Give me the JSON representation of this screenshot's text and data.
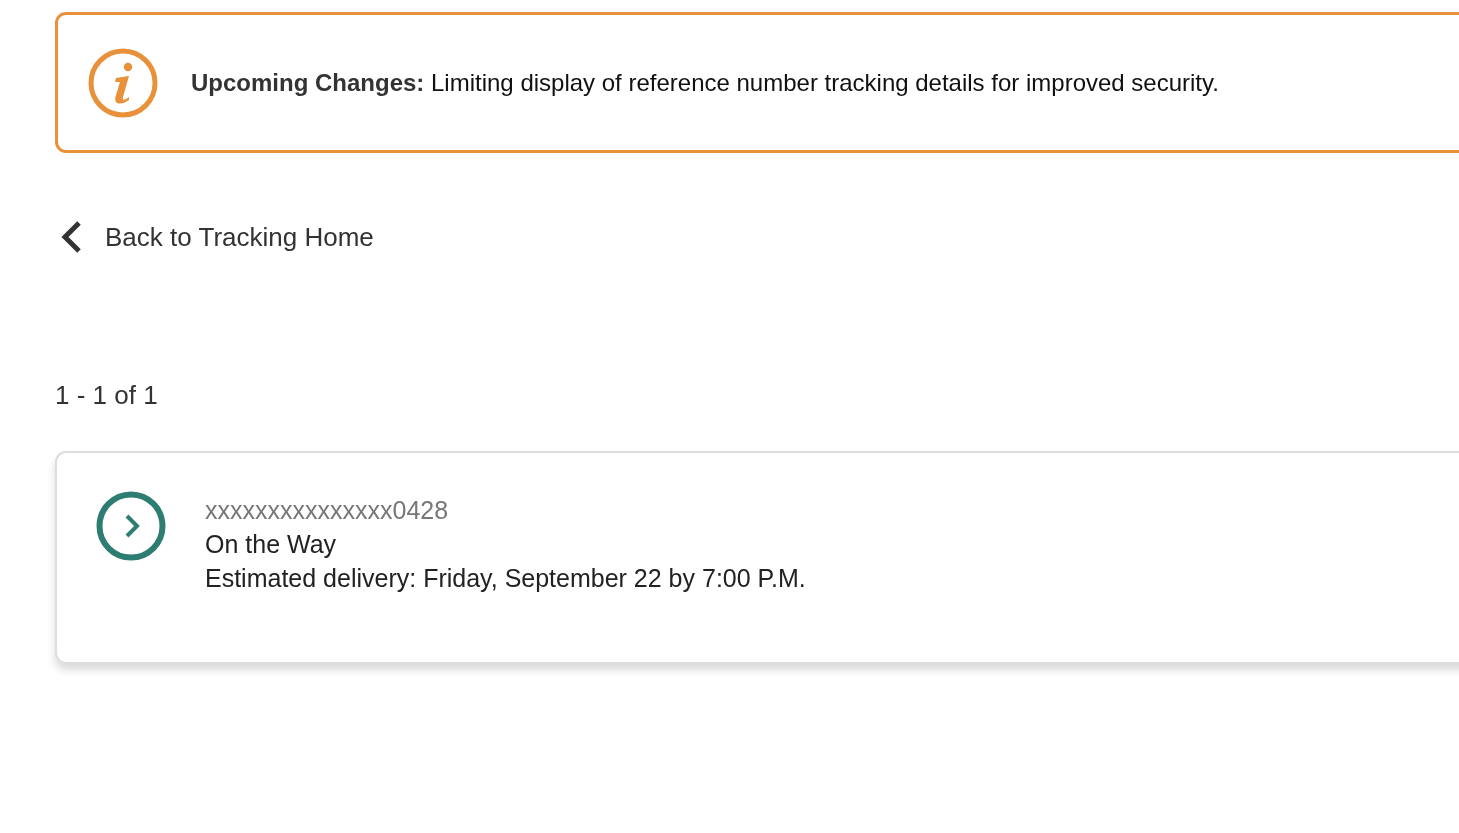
{
  "notice": {
    "text": "**Upcoming Changes:** Limiting display of reference number tracking details for improved security."
  },
  "back_link": {
    "label": "Back to Tracking Home"
  },
  "results_count": "1 - 1 of 1",
  "shipments": [
    {
      "tracking_number": "xxxxxxxxxxxxxxx0428",
      "status": "On the Way",
      "estimated_delivery": "Estimated delivery: Friday, September 22 by 7:00 P.M."
    }
  ]
}
